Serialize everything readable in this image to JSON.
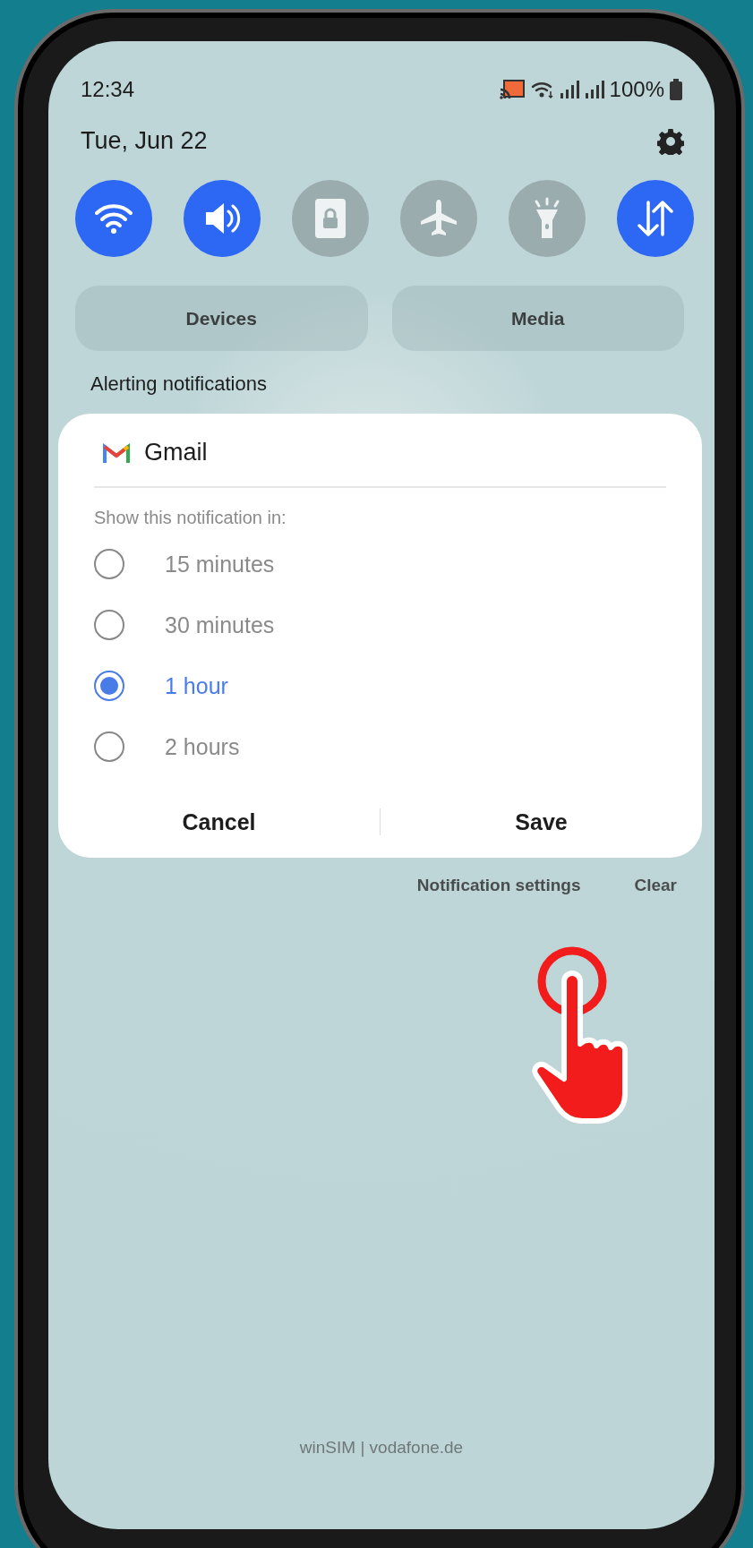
{
  "status_bar": {
    "time": "12:34",
    "battery": "100%"
  },
  "date": "Tue, Jun 22",
  "quick_toggles": [
    {
      "kind": "wifi",
      "on": true
    },
    {
      "kind": "sound",
      "on": true
    },
    {
      "kind": "lock",
      "on": false
    },
    {
      "kind": "airplane",
      "on": false
    },
    {
      "kind": "flashlight",
      "on": false
    },
    {
      "kind": "data",
      "on": true
    }
  ],
  "panel_buttons": [
    "Devices",
    "Media"
  ],
  "section_title": "Alerting notifications",
  "notification": {
    "app": "Gmail",
    "prompt": "Show this notification in:",
    "options": [
      {
        "label": "15 minutes",
        "selected": false
      },
      {
        "label": "30 minutes",
        "selected": false
      },
      {
        "label": "1 hour",
        "selected": true
      },
      {
        "label": "2 hours",
        "selected": false
      }
    ],
    "buttons": [
      "Cancel",
      "Save"
    ]
  },
  "footer_links": [
    "Notification settings",
    "Clear"
  ],
  "carrier": "winSIM | vodafone.de"
}
